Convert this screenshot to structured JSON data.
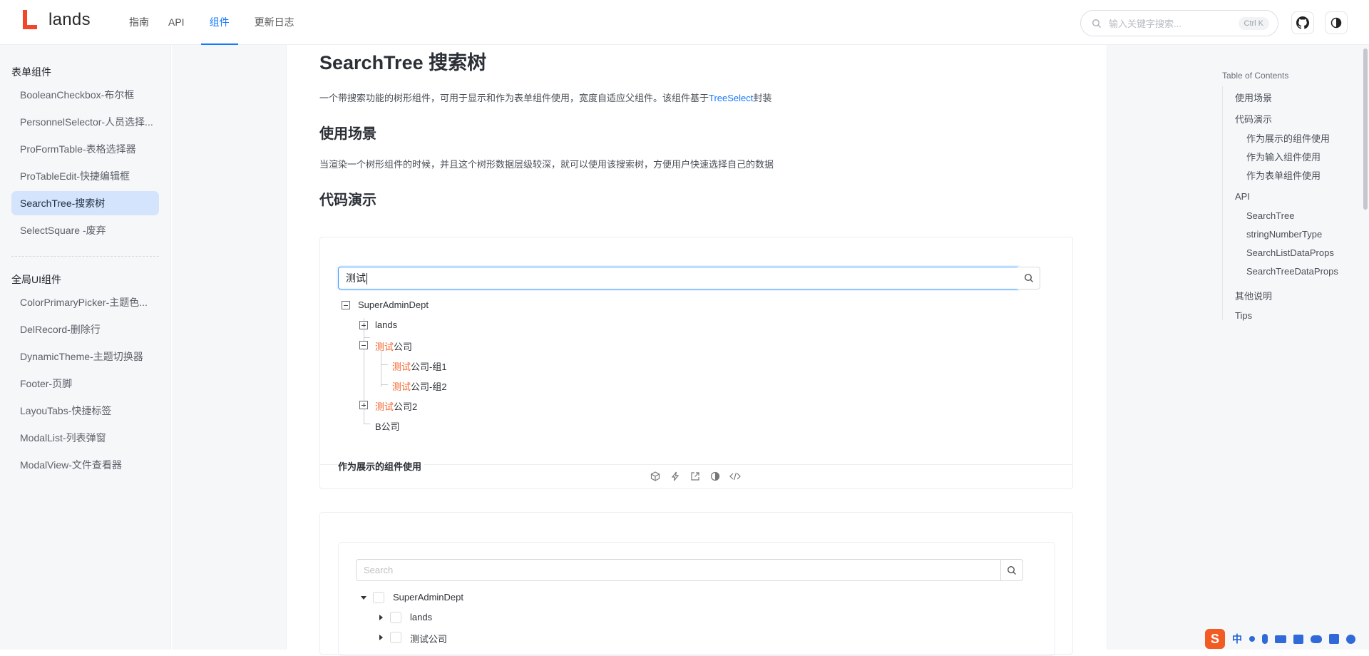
{
  "header": {
    "logo_text": "lands",
    "nav": [
      "指南",
      "API",
      "组件",
      "更新日志"
    ],
    "active_nav": "组件",
    "search_placeholder": "输入关键字搜索...",
    "search_shortcut": "Ctrl K"
  },
  "sidebar": {
    "group1_title": "表单组件",
    "group1_items": [
      "BooleanCheckbox-布尔框",
      "PersonnelSelector-人员选择...",
      "ProFormTable-表格选择器",
      "ProTableEdit-快捷编辑框",
      "SearchTree-搜索树",
      "SelectSquare -废弃"
    ],
    "active_item": "SearchTree-搜索树",
    "group2_title": "全局UI组件",
    "group2_items": [
      "ColorPrimaryPicker-主题色...",
      "DelRecord-删除行",
      "DynamicTheme-主题切换器",
      "Footer-页脚",
      "LayouTabs-快捷标签",
      "ModalList-列表弹窗",
      "ModalView-文件查看器"
    ]
  },
  "main": {
    "title": "SearchTree 搜索树",
    "intro_before_link": "一个带搜索功能的树形组件，可用于显示和作为表单组件使用，宽度自适应父组件。该组件基于",
    "intro_link": "TreeSelect",
    "intro_after_link": "封装",
    "section1_title": "使用场景",
    "section1_text": "当渲染一个树形组件的时候，并且这个树形数据层级较深，就可以使用该搜索树，方便用户快速选择自己的数据",
    "section2_title": "代码演示"
  },
  "demo1": {
    "search_value": "测试",
    "tree": {
      "root": "SuperAdminDept",
      "lands": "lands",
      "node2_hl": "测试",
      "node2_rest": "公司",
      "child1_hl": "测试",
      "child1_rest": "公司-组1",
      "child2_hl": "测试",
      "child2_rest": "公司-组2",
      "node3_hl": "测试",
      "node3_rest": "公司2",
      "node4": "B公司"
    },
    "title": "作为展示的组件使用"
  },
  "demo2": {
    "search_placeholder": "Search",
    "tree": [
      "SuperAdminDept",
      "lands",
      "测试公司"
    ]
  },
  "toc": {
    "title": "Table of Contents",
    "items": [
      {
        "label": "使用场景",
        "level": 1
      },
      {
        "label": "代码演示",
        "level": 1
      },
      {
        "label": "作为展示的组件使用",
        "level": 2
      },
      {
        "label": "作为输入组件使用",
        "level": 2
      },
      {
        "label": "作为表单组件使用",
        "level": 2
      },
      {
        "label": "API",
        "level": 1
      },
      {
        "label": "SearchTree",
        "level": 2
      },
      {
        "label": "stringNumberType",
        "level": 2
      },
      {
        "label": "SearchListDataProps",
        "level": 2
      },
      {
        "label": "SearchTreeDataProps",
        "level": 2
      },
      {
        "label": "其他说明",
        "level": 1
      },
      {
        "label": "Tips",
        "level": 1
      }
    ]
  },
  "ime": {
    "logo": "S",
    "mode": "中"
  },
  "colors": {
    "accent": "#1677ff",
    "highlight": "#f5632a",
    "active_bg": "#d4e4fd"
  }
}
